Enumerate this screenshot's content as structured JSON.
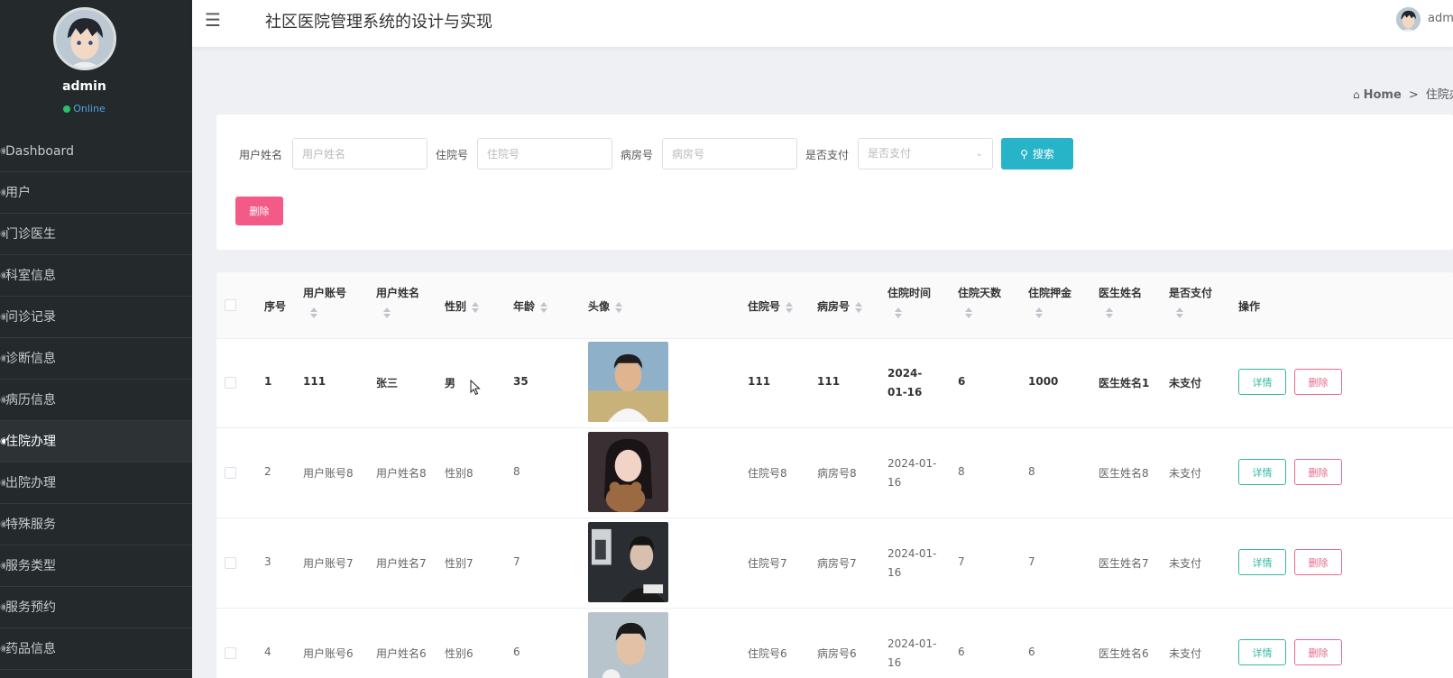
{
  "sidebar": {
    "username": "admin",
    "status": "Online",
    "items": [
      {
        "label": "Dashboard",
        "icon": "dashboard-icon"
      },
      {
        "label": "用户",
        "icon": "user-icon"
      },
      {
        "label": "门诊医生",
        "icon": "doctor-icon"
      },
      {
        "label": "科室信息",
        "icon": "department-icon"
      },
      {
        "label": "问诊记录",
        "icon": "consult-icon"
      },
      {
        "label": "诊断信息",
        "icon": "diagnosis-icon"
      },
      {
        "label": "病历信息",
        "icon": "record-icon"
      },
      {
        "label": "住院办理",
        "icon": "admission-icon",
        "active": true
      },
      {
        "label": "出院办理",
        "icon": "discharge-icon"
      },
      {
        "label": "特殊服务",
        "icon": "service-icon"
      },
      {
        "label": "服务类型",
        "icon": "service-type-icon"
      },
      {
        "label": "服务预约",
        "icon": "appointment-icon"
      },
      {
        "label": "药品信息",
        "icon": "medicine-icon"
      }
    ]
  },
  "header": {
    "title": "社区医院管理系统的设计与实现",
    "user": "adm"
  },
  "breadcrumb": {
    "home": "Home",
    "separator": ">",
    "current": "住院办"
  },
  "search": {
    "fields": [
      {
        "label": "用户姓名",
        "placeholder": "用户姓名"
      },
      {
        "label": "住院号",
        "placeholder": "住院号"
      },
      {
        "label": "病房号",
        "placeholder": "病房号"
      }
    ],
    "select": {
      "label": "是否支付",
      "placeholder": "是否支付"
    },
    "search_button": "搜索",
    "delete_button": "删除"
  },
  "table": {
    "columns": [
      "序号",
      "用户账号",
      "用户姓名",
      "性别",
      "年龄",
      "头像",
      "住院号",
      "病房号",
      "住院时间",
      "住院天数",
      "住院押金",
      "医生姓名",
      "是否支付",
      "操作"
    ],
    "rows": [
      {
        "idx": "1",
        "account": "111",
        "name": "张三",
        "gender": "男",
        "age": "35",
        "inpatient_no": "111",
        "ward_no": "111",
        "date": "2024-01-16",
        "days": "6",
        "deposit": "1000",
        "doctor": "医生姓名1",
        "paid": "未支付"
      },
      {
        "idx": "2",
        "account": "用户账号8",
        "name": "用户姓名8",
        "gender": "性别8",
        "age": "8",
        "inpatient_no": "住院号8",
        "ward_no": "病房号8",
        "date": "2024-01-16",
        "days": "8",
        "deposit": "8",
        "doctor": "医生姓名8",
        "paid": "未支付"
      },
      {
        "idx": "3",
        "account": "用户账号7",
        "name": "用户姓名7",
        "gender": "性别7",
        "age": "7",
        "inpatient_no": "住院号7",
        "ward_no": "病房号7",
        "date": "2024-01-16",
        "days": "7",
        "deposit": "7",
        "doctor": "医生姓名7",
        "paid": "未支付"
      },
      {
        "idx": "4",
        "account": "用户账号6",
        "name": "用户姓名6",
        "gender": "性别6",
        "age": "6",
        "inpatient_no": "住院号6",
        "ward_no": "病房号6",
        "date": "2024-01-16",
        "days": "6",
        "deposit": "6",
        "doctor": "医生姓名6",
        "paid": "未支付"
      }
    ],
    "detail_button": "详情",
    "delete_button": "删除"
  },
  "colors": {
    "sidebar_bg": "#24292b",
    "search_button": "#28b4c8",
    "delete_button": "#f45a88",
    "detail_outline": "#35b8a0",
    "delete_outline": "#e86a8d",
    "online": "#2bc06a"
  }
}
